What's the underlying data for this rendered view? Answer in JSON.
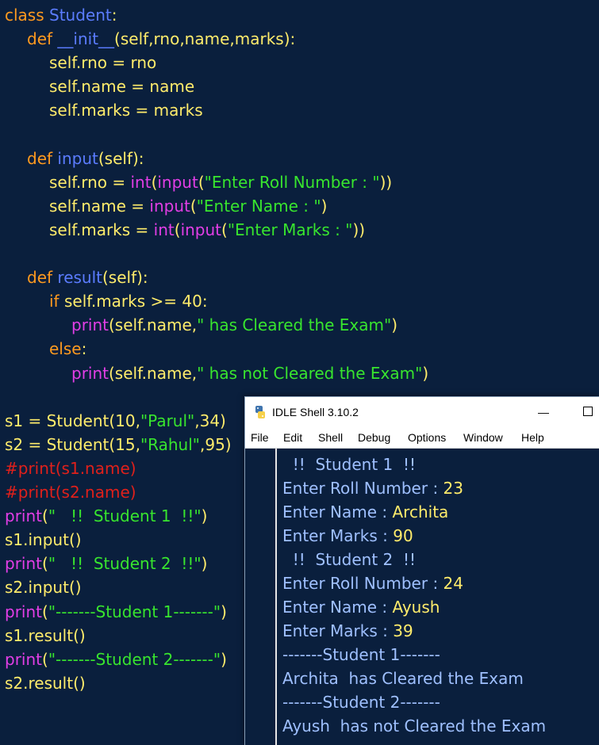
{
  "colors": {
    "background": "#0a1f3d",
    "keyword": "#ff9a1f",
    "name": "#5b7cff",
    "text": "#ffec6b",
    "builtin": "#e23ee6",
    "string": "#38e52e",
    "comment": "#e0201b",
    "shell_input": "#ffec6b",
    "shell_output": "#9fc0ff"
  },
  "editor": {
    "lines": [
      {
        "indent": 0,
        "tokens": [
          {
            "t": "class ",
            "c": "keyword"
          },
          {
            "t": "Student",
            "c": "name"
          },
          {
            "t": ":",
            "c": "text"
          }
        ]
      },
      {
        "indent": 1,
        "tokens": [
          {
            "t": "def ",
            "c": "keyword"
          },
          {
            "t": "__init__",
            "c": "name"
          },
          {
            "t": "(self,rno,name,marks):",
            "c": "text"
          }
        ]
      },
      {
        "indent": 2,
        "tokens": [
          {
            "t": "self.rno = rno",
            "c": "text"
          }
        ]
      },
      {
        "indent": 2,
        "tokens": [
          {
            "t": "self.name = name",
            "c": "text"
          }
        ]
      },
      {
        "indent": 2,
        "tokens": [
          {
            "t": "self.marks = marks",
            "c": "text"
          }
        ]
      },
      {
        "indent": 0,
        "tokens": []
      },
      {
        "indent": 1,
        "tokens": [
          {
            "t": "def ",
            "c": "keyword"
          },
          {
            "t": "input",
            "c": "name"
          },
          {
            "t": "(self):",
            "c": "text"
          }
        ]
      },
      {
        "indent": 2,
        "tokens": [
          {
            "t": "self.rno = ",
            "c": "text"
          },
          {
            "t": "int",
            "c": "builtin"
          },
          {
            "t": "(",
            "c": "text"
          },
          {
            "t": "input",
            "c": "builtin"
          },
          {
            "t": "(",
            "c": "text"
          },
          {
            "t": "\"Enter Roll Number : \"",
            "c": "string"
          },
          {
            "t": "))",
            "c": "text"
          }
        ]
      },
      {
        "indent": 2,
        "tokens": [
          {
            "t": "self.name = ",
            "c": "text"
          },
          {
            "t": "input",
            "c": "builtin"
          },
          {
            "t": "(",
            "c": "text"
          },
          {
            "t": "\"Enter Name : \"",
            "c": "string"
          },
          {
            "t": ")",
            "c": "text"
          }
        ]
      },
      {
        "indent": 2,
        "tokens": [
          {
            "t": "self.marks = ",
            "c": "text"
          },
          {
            "t": "int",
            "c": "builtin"
          },
          {
            "t": "(",
            "c": "text"
          },
          {
            "t": "input",
            "c": "builtin"
          },
          {
            "t": "(",
            "c": "text"
          },
          {
            "t": "\"Enter Marks : \"",
            "c": "string"
          },
          {
            "t": "))",
            "c": "text"
          }
        ]
      },
      {
        "indent": 0,
        "tokens": []
      },
      {
        "indent": 1,
        "tokens": [
          {
            "t": "def ",
            "c": "keyword"
          },
          {
            "t": "result",
            "c": "name"
          },
          {
            "t": "(self):",
            "c": "text"
          }
        ]
      },
      {
        "indent": 2,
        "tokens": [
          {
            "t": "if ",
            "c": "keyword"
          },
          {
            "t": "self.marks >= 40:",
            "c": "text"
          }
        ]
      },
      {
        "indent": 3,
        "tokens": [
          {
            "t": "print",
            "c": "builtin"
          },
          {
            "t": "(self.name,",
            "c": "text"
          },
          {
            "t": "\" has Cleared the Exam\"",
            "c": "string"
          },
          {
            "t": ")",
            "c": "text"
          }
        ]
      },
      {
        "indent": 2,
        "tokens": [
          {
            "t": "else",
            "c": "keyword"
          },
          {
            "t": ":",
            "c": "text"
          }
        ]
      },
      {
        "indent": 3,
        "tokens": [
          {
            "t": "print",
            "c": "builtin"
          },
          {
            "t": "(self.name,",
            "c": "text"
          },
          {
            "t": "\" has not Cleared the Exam\"",
            "c": "string"
          },
          {
            "t": ")",
            "c": "text"
          }
        ]
      },
      {
        "indent": 0,
        "tokens": []
      },
      {
        "indent": 0,
        "tokens": [
          {
            "t": "s1 = ",
            "c": "text"
          },
          {
            "t": "Student",
            "c": "text"
          },
          {
            "t": "(10,",
            "c": "text"
          },
          {
            "t": "\"Parul\"",
            "c": "string"
          },
          {
            "t": ",34)",
            "c": "text"
          }
        ]
      },
      {
        "indent": 0,
        "tokens": [
          {
            "t": "s2 = ",
            "c": "text"
          },
          {
            "t": "Student",
            "c": "text"
          },
          {
            "t": "(15,",
            "c": "text"
          },
          {
            "t": "\"Rahul\"",
            "c": "string"
          },
          {
            "t": ",95)",
            "c": "text"
          }
        ]
      },
      {
        "indent": 0,
        "tokens": [
          {
            "t": "#print(s1.name)",
            "c": "comment"
          }
        ]
      },
      {
        "indent": 0,
        "tokens": [
          {
            "t": "#print(s2.name)",
            "c": "comment"
          }
        ]
      },
      {
        "indent": 0,
        "tokens": [
          {
            "t": "print",
            "c": "builtin"
          },
          {
            "t": "(",
            "c": "text"
          },
          {
            "t": "\"   !!  Student 1  !!\"",
            "c": "string"
          },
          {
            "t": ")",
            "c": "text"
          }
        ]
      },
      {
        "indent": 0,
        "tokens": [
          {
            "t": "s1.input()",
            "c": "text"
          }
        ]
      },
      {
        "indent": 0,
        "tokens": [
          {
            "t": "print",
            "c": "builtin"
          },
          {
            "t": "(",
            "c": "text"
          },
          {
            "t": "\"   !!  Student 2  !!\"",
            "c": "string"
          },
          {
            "t": ")",
            "c": "text"
          }
        ]
      },
      {
        "indent": 0,
        "tokens": [
          {
            "t": "s2.input()",
            "c": "text"
          }
        ]
      },
      {
        "indent": 0,
        "tokens": [
          {
            "t": "print",
            "c": "builtin"
          },
          {
            "t": "(",
            "c": "text"
          },
          {
            "t": "\"-------Student 1-------\"",
            "c": "string"
          },
          {
            "t": ")",
            "c": "text"
          }
        ]
      },
      {
        "indent": 0,
        "tokens": [
          {
            "t": "s1.result()",
            "c": "text"
          }
        ]
      },
      {
        "indent": 0,
        "tokens": [
          {
            "t": "print",
            "c": "builtin"
          },
          {
            "t": "(",
            "c": "text"
          },
          {
            "t": "\"-------Student 2-------\"",
            "c": "string"
          },
          {
            "t": ")",
            "c": "text"
          }
        ]
      },
      {
        "indent": 0,
        "tokens": [
          {
            "t": "s2.result()",
            "c": "text"
          }
        ]
      }
    ]
  },
  "idle": {
    "title": "IDLE Shell 3.10.2",
    "minimize_label": "—",
    "menu": [
      "File",
      "Edit",
      "Shell",
      "Debug",
      "Options",
      "Window",
      "Help"
    ],
    "output": [
      {
        "tokens": [
          {
            "t": "  !!  Student 1  !!",
            "c": "shell_output"
          }
        ]
      },
      {
        "tokens": [
          {
            "t": "Enter Roll Number : ",
            "c": "shell_output"
          },
          {
            "t": "23",
            "c": "shell_input"
          }
        ]
      },
      {
        "tokens": [
          {
            "t": "Enter Name : ",
            "c": "shell_output"
          },
          {
            "t": "Archita",
            "c": "shell_input"
          }
        ]
      },
      {
        "tokens": [
          {
            "t": "Enter Marks : ",
            "c": "shell_output"
          },
          {
            "t": "90",
            "c": "shell_input"
          }
        ]
      },
      {
        "tokens": [
          {
            "t": "  !!  Student 2  !!",
            "c": "shell_output"
          }
        ]
      },
      {
        "tokens": [
          {
            "t": "Enter Roll Number : ",
            "c": "shell_output"
          },
          {
            "t": "24",
            "c": "shell_input"
          }
        ]
      },
      {
        "tokens": [
          {
            "t": "Enter Name : ",
            "c": "shell_output"
          },
          {
            "t": "Ayush",
            "c": "shell_input"
          }
        ]
      },
      {
        "tokens": [
          {
            "t": "Enter Marks : ",
            "c": "shell_output"
          },
          {
            "t": "39",
            "c": "shell_input"
          }
        ]
      },
      {
        "tokens": [
          {
            "t": "-------Student 1-------",
            "c": "shell_output"
          }
        ]
      },
      {
        "tokens": [
          {
            "t": "Archita  has Cleared the Exam",
            "c": "shell_output"
          }
        ]
      },
      {
        "tokens": [
          {
            "t": "-------Student 2-------",
            "c": "shell_output"
          }
        ]
      },
      {
        "tokens": [
          {
            "t": "Ayush  has not Cleared the Exam",
            "c": "shell_output"
          }
        ]
      }
    ]
  }
}
